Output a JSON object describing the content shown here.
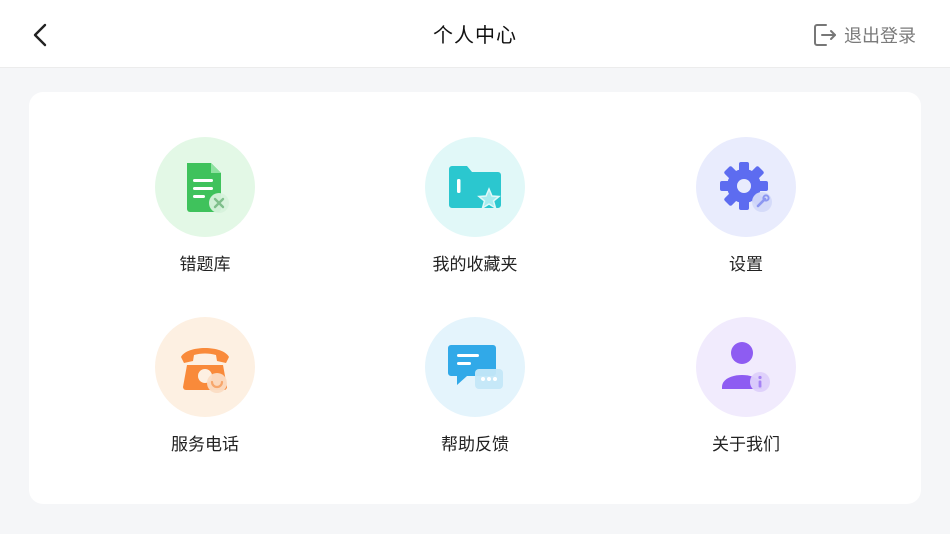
{
  "header": {
    "title": "个人中心",
    "logout_label": "退出登录"
  },
  "menu": {
    "items": [
      {
        "label": "错题库",
        "icon": "wrong-question-bank-icon",
        "bg": "#e3f8e6",
        "accent": "#3fc25c"
      },
      {
        "label": "我的收藏夹",
        "icon": "favorites-folder-icon",
        "bg": "#e1f8f8",
        "accent": "#2bc7cf"
      },
      {
        "label": "设置",
        "icon": "gear-icon",
        "bg": "#e9ecfd",
        "accent": "#5d6cf0"
      },
      {
        "label": "服务电话",
        "icon": "phone-icon",
        "bg": "#fdf0e2",
        "accent": "#f98a3a"
      },
      {
        "label": "帮助反馈",
        "icon": "feedback-chat-icon",
        "bg": "#e4f4fc",
        "accent": "#31a9e8"
      },
      {
        "label": "关于我们",
        "icon": "about-us-person-icon",
        "bg": "#f1ebfd",
        "accent": "#8e5cf2"
      }
    ]
  }
}
